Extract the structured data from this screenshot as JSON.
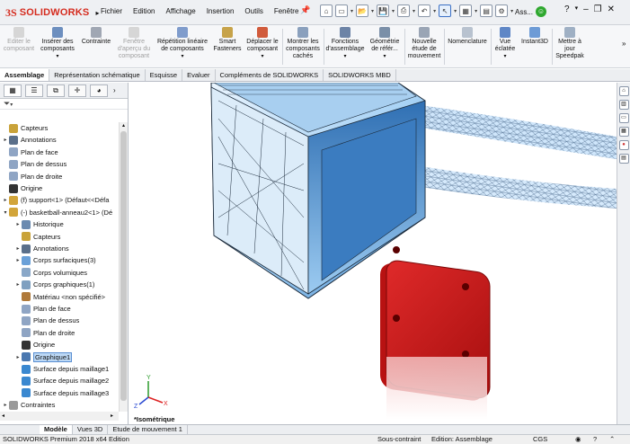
{
  "app": {
    "logo_text": "SOLIDWORKS"
  },
  "menu": [
    "Fichier",
    "Edition",
    "Affichage",
    "Insertion",
    "Outils",
    "Fenêtre"
  ],
  "user": {
    "label": "Ass..."
  },
  "ribbon": [
    {
      "label": "Editer le composant",
      "disabled": true
    },
    {
      "label": "Insérer des composants",
      "disabled": false
    },
    {
      "label": "Contrainte",
      "disabled": false
    },
    {
      "label": "Fenêtre d'aperçu du composant",
      "disabled": true
    },
    {
      "label": "Répétition linéaire de composants",
      "disabled": false
    },
    {
      "label": "Smart Fasteners",
      "disabled": false
    },
    {
      "label": "Déplacer le composant",
      "disabled": false
    },
    {
      "label": "Montrer les composants cachés",
      "disabled": false
    },
    {
      "label": "Fonctions d'assemblage",
      "disabled": false
    },
    {
      "label": "Géométrie de référ...",
      "disabled": false
    },
    {
      "label": "Nouvelle étude de mouvement",
      "disabled": false
    },
    {
      "label": "Nomenclature",
      "disabled": false
    },
    {
      "label": "Vue éclatée",
      "disabled": false
    },
    {
      "label": "Instant3D",
      "disabled": false
    },
    {
      "label": "Mettre à jour Speedpak",
      "disabled": false
    }
  ],
  "command_tabs": [
    "Assemblage",
    "Représentation schématique",
    "Esquisse",
    "Evaluer",
    "Compléments de SOLIDWORKS",
    "SOLIDWORKS MBD"
  ],
  "active_command_tab": "Assemblage",
  "tree": [
    {
      "label": "Capteurs",
      "indent": 0,
      "expand": "",
      "icon": "sensor-icon"
    },
    {
      "label": "Annotations",
      "indent": 0,
      "expand": "▸",
      "icon": "annotations-icon"
    },
    {
      "label": "Plan de face",
      "indent": 0,
      "expand": "",
      "icon": "plane-icon"
    },
    {
      "label": "Plan de dessus",
      "indent": 0,
      "expand": "",
      "icon": "plane-icon"
    },
    {
      "label": "Plan de droite",
      "indent": 0,
      "expand": "",
      "icon": "plane-icon"
    },
    {
      "label": "Origine",
      "indent": 0,
      "expand": "",
      "icon": "origin-icon"
    },
    {
      "label": "(f) support<1> (Défaut<<Défa",
      "indent": 0,
      "expand": "▸",
      "icon": "part-icon"
    },
    {
      "label": "(-) basketball-anneau2<1> (Dé",
      "indent": 0,
      "expand": "▾",
      "icon": "part-icon"
    },
    {
      "label": "Historique",
      "indent": 1,
      "expand": "▸",
      "icon": "history-icon"
    },
    {
      "label": "Capteurs",
      "indent": 1,
      "expand": "",
      "icon": "sensor-icon"
    },
    {
      "label": "Annotations",
      "indent": 1,
      "expand": "▸",
      "icon": "annotations-icon"
    },
    {
      "label": "Corps surfaciques(3)",
      "indent": 1,
      "expand": "▸",
      "icon": "surface-bodies-icon"
    },
    {
      "label": "Corps volumiques",
      "indent": 1,
      "expand": "",
      "icon": "solid-bodies-icon"
    },
    {
      "label": "Corps graphiques(1)",
      "indent": 1,
      "expand": "▸",
      "icon": "graphic-bodies-icon"
    },
    {
      "label": "Matériau <non spécifié>",
      "indent": 1,
      "expand": "",
      "icon": "material-icon"
    },
    {
      "label": "Plan de face",
      "indent": 1,
      "expand": "",
      "icon": "plane-icon"
    },
    {
      "label": "Plan de dessus",
      "indent": 1,
      "expand": "",
      "icon": "plane-icon"
    },
    {
      "label": "Plan de droite",
      "indent": 1,
      "expand": "",
      "icon": "plane-icon"
    },
    {
      "label": "Origine",
      "indent": 1,
      "expand": "",
      "icon": "origin-icon"
    },
    {
      "label": "Graphique1",
      "indent": 1,
      "expand": "▸",
      "icon": "graphic-feature-icon",
      "selected": true
    },
    {
      "label": "Surface depuis maillage1",
      "indent": 1,
      "expand": "",
      "icon": "mesh-surface-icon"
    },
    {
      "label": "Surface depuis maillage2",
      "indent": 1,
      "expand": "",
      "icon": "mesh-surface-icon"
    },
    {
      "label": "Surface depuis maillage3",
      "indent": 1,
      "expand": "",
      "icon": "mesh-surface-icon"
    },
    {
      "label": "Contraintes",
      "indent": 0,
      "expand": "▸",
      "icon": "mates-icon"
    }
  ],
  "viewport": {
    "view_label": "*Isométrique"
  },
  "bottom_tabs": [
    "Modèle",
    "Vues 3D",
    "Etude de mouvement 1"
  ],
  "active_bottom_tab": "Modèle",
  "status": {
    "edition": "SOLIDWORKS Premium 2018 x64 Edition",
    "constraint": "Sous-contraint",
    "mode": "Edition: Assemblage",
    "units": "CGS"
  }
}
